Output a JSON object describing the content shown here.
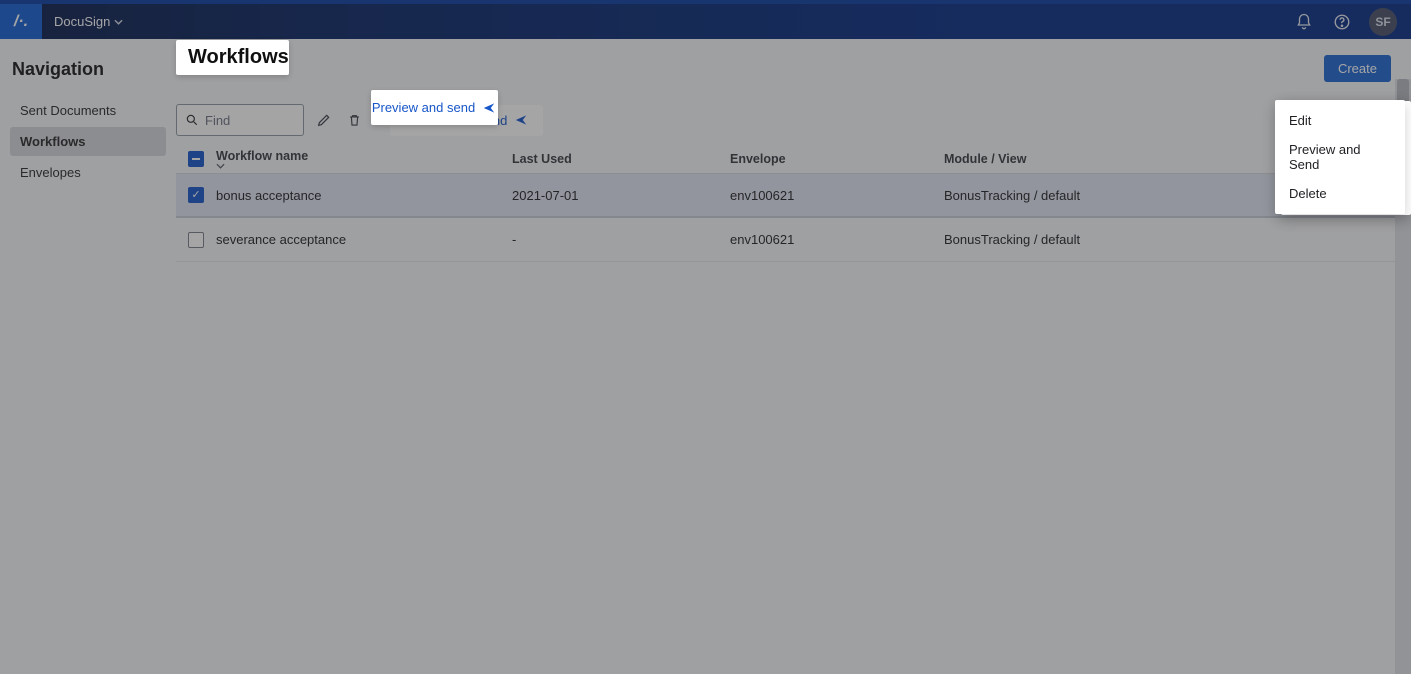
{
  "colors": {
    "primary": "#1560d0",
    "accent": "#1756c8"
  },
  "topbar": {
    "app_name": "DocuSign",
    "avatar_initials": "SF"
  },
  "sidebar": {
    "title": "Navigation",
    "items": [
      {
        "label": "Sent Documents",
        "active": false
      },
      {
        "label": "Workflows",
        "active": true
      },
      {
        "label": "Envelopes",
        "active": false
      }
    ]
  },
  "page": {
    "title": "Workflows",
    "create_label": "Create"
  },
  "toolbar": {
    "search_placeholder": "Find",
    "preview_send_label": "Preview and send"
  },
  "table": {
    "columns": {
      "name": "Workflow name",
      "last_used": "Last Used",
      "envelope": "Envelope",
      "module_view": "Module / View"
    },
    "rows": [
      {
        "selected": true,
        "name": "bonus acceptance",
        "last_used": "2021-07-01",
        "envelope": "env100621",
        "module_view": "BonusTracking / default"
      },
      {
        "selected": false,
        "name": "severance acceptance",
        "last_used": "-",
        "envelope": "env100621",
        "module_view": "BonusTracking / default"
      }
    ]
  },
  "context_menu": {
    "items": [
      {
        "label": "Edit"
      },
      {
        "label": "Preview and Send"
      },
      {
        "label": "Delete"
      }
    ]
  }
}
